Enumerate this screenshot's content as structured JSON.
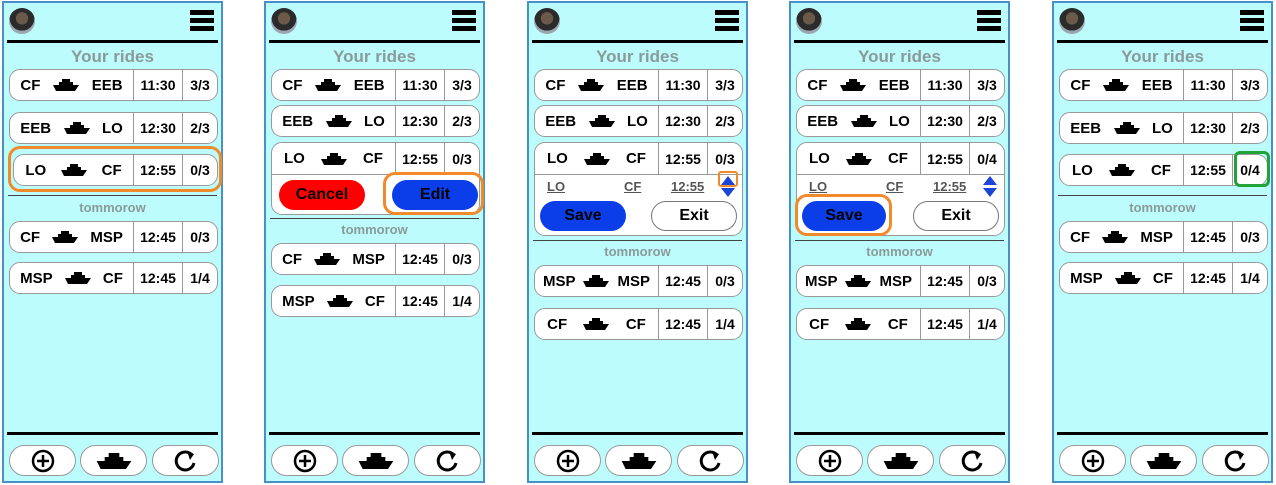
{
  "labels": {
    "your_rides": "Your rides",
    "tomorrow": "tommorow",
    "cancel": "Cancel",
    "edit": "Edit",
    "save": "Save",
    "exit": "Exit"
  },
  "icons": {
    "avatar": "user-avatar",
    "menu": "hamburger-menu-icon",
    "add": "plus-circle-icon",
    "boat": "boat-icon",
    "refresh": "refresh-icon"
  },
  "colors": {
    "screen_bg": "#bdfcfc",
    "highlight_orange": "#f08a2a",
    "highlight_green": "#22a33a",
    "cancel_red": "#ff0000",
    "action_blue": "#0b3ee8"
  },
  "screens": [
    {
      "today": [
        {
          "from": "CF",
          "to": "EEB",
          "time": "11:30",
          "seats": "3/3"
        },
        {
          "from": "EEB",
          "to": "LO",
          "time": "12:30",
          "seats": "2/3"
        },
        {
          "from": "LO",
          "to": "CF",
          "time": "12:55",
          "seats": "0/3"
        }
      ],
      "tomorrow": [
        {
          "from": "CF",
          "to": "MSP",
          "time": "12:45",
          "seats": "0/3"
        },
        {
          "from": "MSP",
          "to": "CF",
          "time": "12:45",
          "seats": "1/4"
        }
      ]
    },
    {
      "today": [
        {
          "from": "CF",
          "to": "EEB",
          "time": "11:30",
          "seats": "3/3"
        },
        {
          "from": "EEB",
          "to": "LO",
          "time": "12:30",
          "seats": "2/3"
        },
        {
          "from": "LO",
          "to": "CF",
          "time": "12:55",
          "seats": "0/3"
        }
      ],
      "tomorrow": [
        {
          "from": "CF",
          "to": "MSP",
          "time": "12:45",
          "seats": "0/3"
        },
        {
          "from": "MSP",
          "to": "CF",
          "time": "12:45",
          "seats": "1/4"
        }
      ]
    },
    {
      "today": [
        {
          "from": "CF",
          "to": "EEB",
          "time": "11:30",
          "seats": "3/3"
        },
        {
          "from": "EEB",
          "to": "LO",
          "time": "12:30",
          "seats": "2/3"
        },
        {
          "from": "LO",
          "to": "CF",
          "time": "12:55",
          "seats": "0/3"
        }
      ],
      "edit": {
        "from": "LO",
        "to": "CF",
        "time": "12:55"
      },
      "tomorrow": [
        {
          "from": "MSP",
          "to": "MSP",
          "time": "12:45",
          "seats": "0/3"
        },
        {
          "from": "CF",
          "to": "CF",
          "time": "12:45",
          "seats": "1/4"
        }
      ]
    },
    {
      "today": [
        {
          "from": "CF",
          "to": "EEB",
          "time": "11:30",
          "seats": "3/3"
        },
        {
          "from": "EEB",
          "to": "LO",
          "time": "12:30",
          "seats": "2/3"
        },
        {
          "from": "LO",
          "to": "CF",
          "time": "12:55",
          "seats": "0/4"
        }
      ],
      "edit": {
        "from": "LO",
        "to": "CF",
        "time": "12:55"
      },
      "tomorrow": [
        {
          "from": "MSP",
          "to": "MSP",
          "time": "12:45",
          "seats": "0/3"
        },
        {
          "from": "CF",
          "to": "CF",
          "time": "12:45",
          "seats": "1/4"
        }
      ]
    },
    {
      "today": [
        {
          "from": "CF",
          "to": "EEB",
          "time": "11:30",
          "seats": "3/3"
        },
        {
          "from": "EEB",
          "to": "LO",
          "time": "12:30",
          "seats": "2/3"
        },
        {
          "from": "LO",
          "to": "CF",
          "time": "12:55",
          "seats": "0/4"
        }
      ],
      "tomorrow": [
        {
          "from": "CF",
          "to": "MSP",
          "time": "12:45",
          "seats": "0/3"
        },
        {
          "from": "MSP",
          "to": "CF",
          "time": "12:45",
          "seats": "1/4"
        }
      ]
    }
  ]
}
